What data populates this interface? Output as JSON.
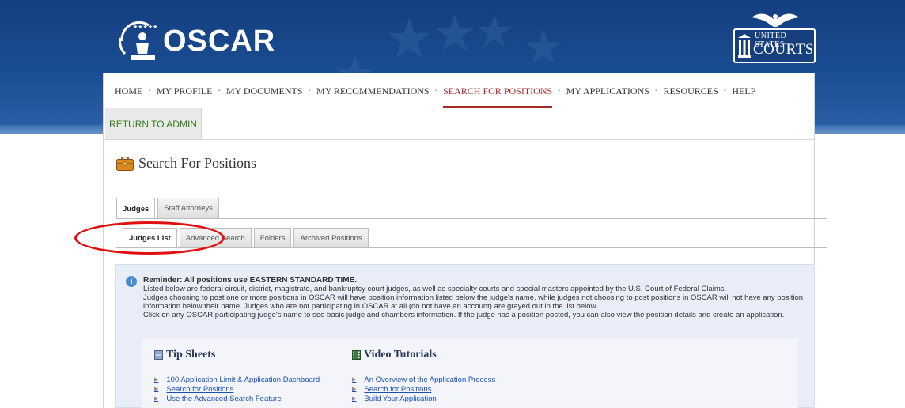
{
  "app": {
    "logo_text": "OSCAR",
    "courts_line1": "UNITED STATES",
    "courts_line2": "COURTS"
  },
  "nav": {
    "items": [
      {
        "label": "HOME"
      },
      {
        "label": "MY PROFILE"
      },
      {
        "label": "MY DOCUMENTS"
      },
      {
        "label": "MY RECOMMENDATIONS"
      },
      {
        "label": "SEARCH FOR POSITIONS",
        "active": true
      },
      {
        "label": "MY APPLICATIONS"
      },
      {
        "label": "RESOURCES"
      },
      {
        "label": "HELP"
      }
    ],
    "return_admin": "RETURN TO ADMIN"
  },
  "page": {
    "title": "Search For Positions",
    "icon": "briefcase-icon"
  },
  "tabs_primary": [
    {
      "label": "Judges",
      "active": true
    },
    {
      "label": "Staff Attorneys"
    }
  ],
  "tabs_secondary": [
    {
      "label": "Judges List",
      "active": true
    },
    {
      "label": "Advanced Search"
    },
    {
      "label": "Folders"
    },
    {
      "label": "Archived Positions"
    }
  ],
  "info": {
    "reminder": "Reminder: All positions use EASTERN STANDARD TIME.",
    "line1": "Listed below are federal circuit, district, magistrate, and bankruptcy court judges, as well as specialty courts and special masters appointed by the U.S. Court of Federal Claims.",
    "line2": "Judges choosing to post one or more positions in OSCAR will have position information listed below the judge's name, while judges not choosing to post positions in OSCAR will not have any position information below their name.  Judges who are not participating in OSCAR at all (do not have an account) are grayed out in the list below.",
    "line3": "Click on any OSCAR participating judge's name to see basic judge and chambers information.  If the judge has a position posted, you can also view the position details and create an application."
  },
  "tip_sheets": {
    "heading": "Tip Sheets",
    "links": [
      "100 Application Limit & Application Dashboard",
      "Search for Positions",
      "Use the Advanced Search Feature"
    ]
  },
  "video_tutorials": {
    "heading": "Video Tutorials",
    "links": [
      "An Overview of the Application Process",
      "Search for Positions",
      "Build Your Application"
    ]
  },
  "colors": {
    "header_blue": "#1b4d92",
    "active_nav": "#a52a2a",
    "admin_green": "#3a7d1e",
    "link_blue": "#1a4fae",
    "annotation_red": "#e01010"
  }
}
